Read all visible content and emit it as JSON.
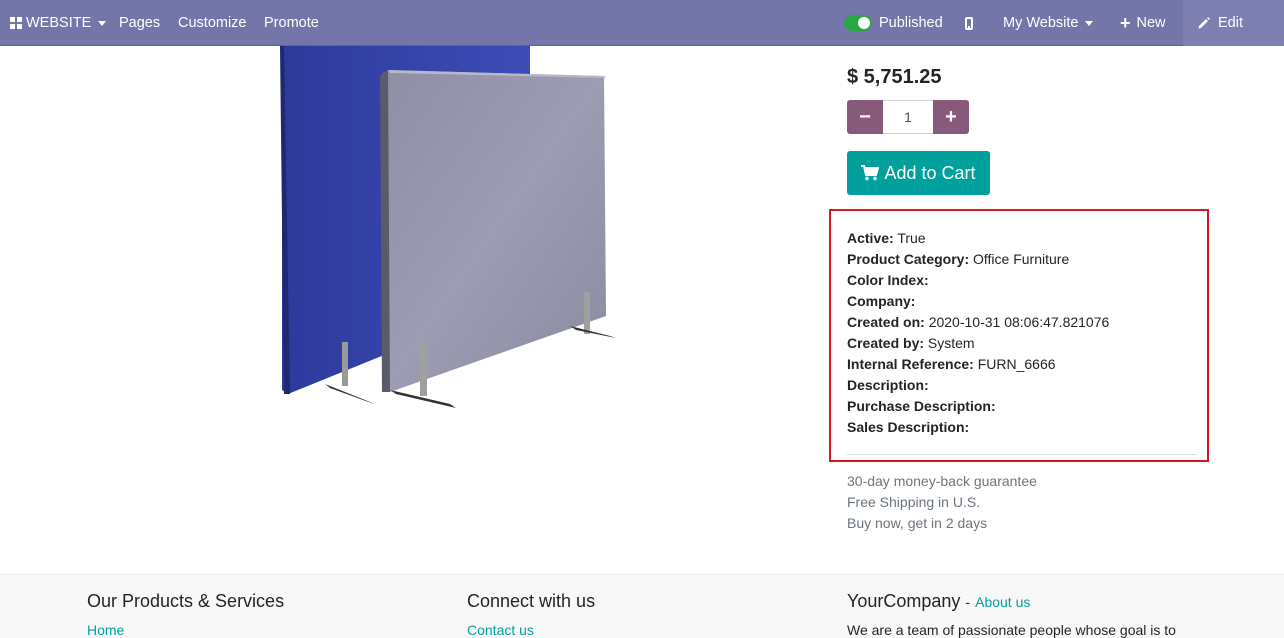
{
  "topbar": {
    "website_label": "WEBSITE",
    "pages_label": "Pages",
    "customize_label": "Customize",
    "promote_label": "Promote",
    "published_label": "Published",
    "my_website_label": "My Website",
    "new_label": "New",
    "edit_label": "Edit",
    "bar_color": "#7476aa",
    "toggle_color": "#28a745"
  },
  "product": {
    "price": "$ 5,751.25",
    "quantity": "1",
    "add_to_cart_label": "Add to Cart",
    "accent_color": "#00a09d",
    "qty_button_color": "#875a7b",
    "details": [
      {
        "label": "Active:",
        "value": "True"
      },
      {
        "label": "Product Category:",
        "value": "Office Furniture"
      },
      {
        "label": "Color Index:",
        "value": ""
      },
      {
        "label": "Company:",
        "value": ""
      },
      {
        "label": "Created on:",
        "value": "2020-10-31 08:06:47.821076"
      },
      {
        "label": "Created by:",
        "value": "System"
      },
      {
        "label": "Internal Reference:",
        "value": "FURN_6666"
      },
      {
        "label": "Description:",
        "value": ""
      },
      {
        "label": "Purchase Description:",
        "value": ""
      },
      {
        "label": "Sales Description:",
        "value": ""
      }
    ],
    "highlight_color": "#d9161f",
    "perks": [
      "30-day money-back guarantee",
      "Free Shipping in U.S.",
      "Buy now, get in 2 days"
    ]
  },
  "footer": {
    "products_title": "Our Products & Services",
    "products_link": "Home",
    "connect_title": "Connect with us",
    "connect_link": "Contact us",
    "company_name": "YourCompany",
    "company_separator": "-",
    "about_link": "About us",
    "company_text": "We are a team of passionate people whose goal is to"
  }
}
